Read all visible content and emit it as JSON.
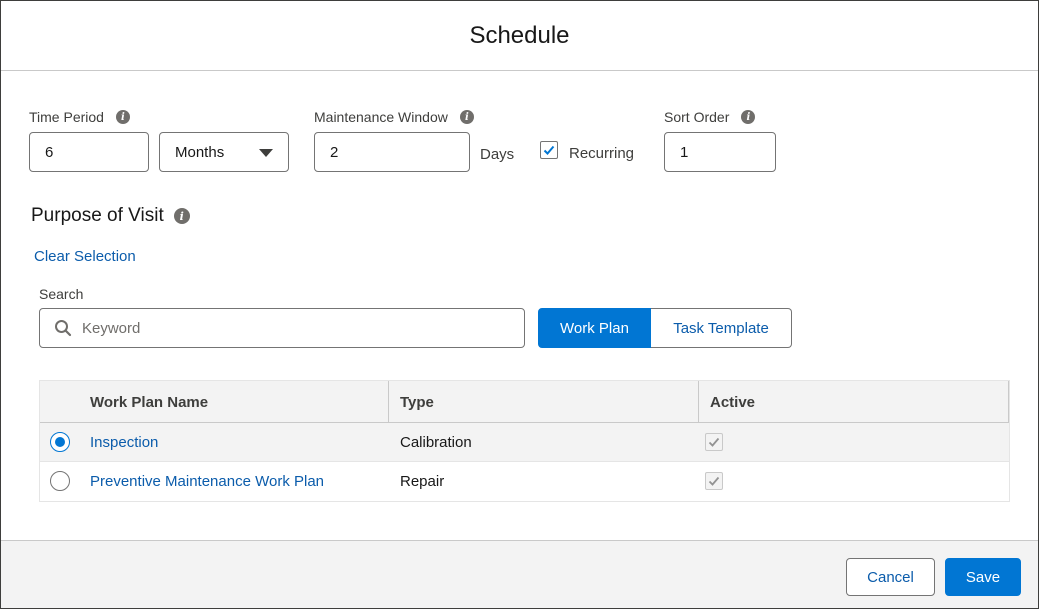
{
  "modal": {
    "title": "Schedule"
  },
  "form": {
    "time_period": {
      "label": "Time Period",
      "value": "6",
      "unit": "Months"
    },
    "maintenance_window": {
      "label": "Maintenance Window",
      "value": "2",
      "unit_label": "Days"
    },
    "recurring": {
      "label": "Recurring",
      "checked": true
    },
    "sort_order": {
      "label": "Sort Order",
      "value": "1"
    }
  },
  "purpose": {
    "title": "Purpose of Visit",
    "clear_selection": "Clear Selection",
    "search_label": "Search",
    "search_placeholder": "Keyword",
    "toggle": {
      "active": "Work Plan",
      "inactive": "Task Template"
    }
  },
  "table": {
    "columns": [
      "Work Plan Name",
      "Type",
      "Active"
    ],
    "rows": [
      {
        "name": "Inspection",
        "type": "Calibration",
        "active": true,
        "selected": true
      },
      {
        "name": "Preventive Maintenance Work Plan",
        "type": "Repair",
        "active": true,
        "selected": false
      }
    ]
  },
  "footer": {
    "cancel": "Cancel",
    "save": "Save"
  },
  "colors": {
    "brand": "#0176d3",
    "link": "#0b5cab",
    "neutral_bg": "#f3f3f3"
  }
}
